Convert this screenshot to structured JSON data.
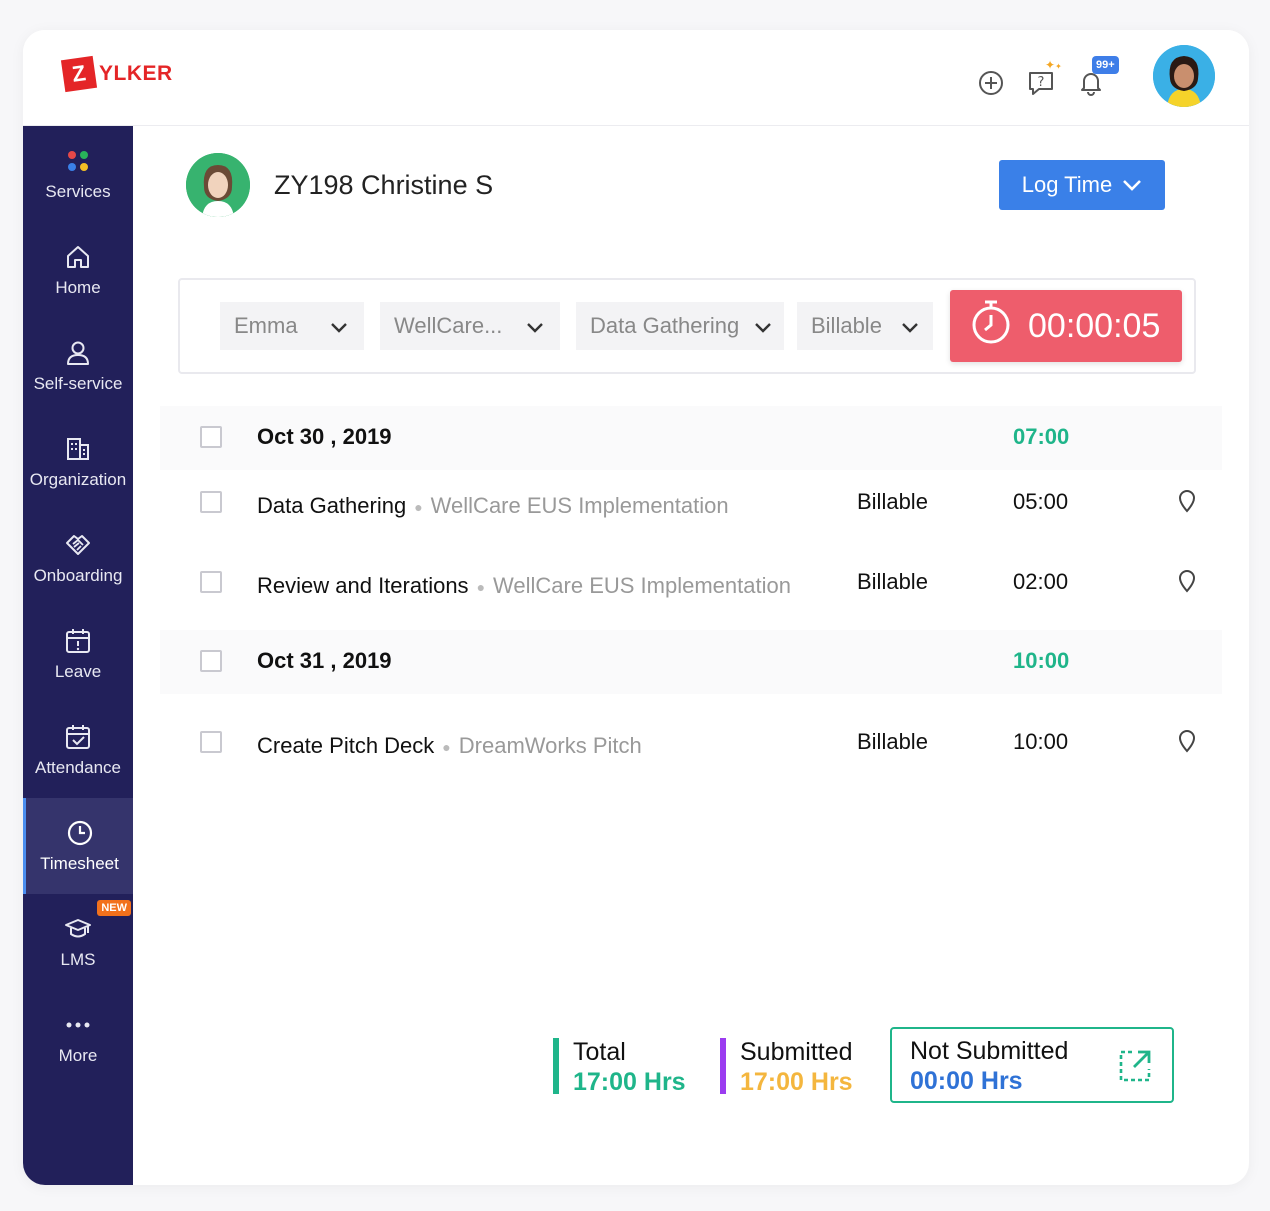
{
  "brand": {
    "logo_letter": "Z",
    "logo_text": "YLKER",
    "color": "#e42527"
  },
  "header": {
    "icons": [
      "add-icon",
      "help-icon",
      "bell-icon"
    ],
    "notification_badge": "99+",
    "profile_avatar": "user-avatar"
  },
  "sidebar": {
    "items": [
      {
        "label": "Services",
        "icon": "services-icon"
      },
      {
        "label": "Home",
        "icon": "home-icon"
      },
      {
        "label": "Self-service",
        "icon": "person-icon"
      },
      {
        "label": "Organization",
        "icon": "building-icon"
      },
      {
        "label": "Onboarding",
        "icon": "handshake-icon"
      },
      {
        "label": "Leave",
        "icon": "calendar-icon"
      },
      {
        "label": "Attendance",
        "icon": "calendar-check-icon"
      },
      {
        "label": "Timesheet",
        "icon": "clock-icon",
        "active": true
      },
      {
        "label": "LMS",
        "icon": "graduation-icon",
        "badge": "NEW"
      },
      {
        "label": "More",
        "icon": "more-icon"
      }
    ]
  },
  "profile": {
    "name": "ZY198 Christine S"
  },
  "log_time": {
    "label": "Log Time"
  },
  "filters": {
    "user": "Emma",
    "project": "WellCare...",
    "job": "Data Gathering",
    "billing": "Billable"
  },
  "timer": {
    "value": "00:00:05"
  },
  "entries": [
    {
      "type": "date",
      "label": "Oct 30 , 2019",
      "hours": "07:00"
    },
    {
      "type": "log",
      "job": "Data Gathering",
      "project": "WellCare EUS Implementation",
      "billing": "Billable",
      "hours": "05:00"
    },
    {
      "type": "log",
      "job": "Review and Iterations",
      "project": "WellCare EUS Implementation",
      "billing": "Billable",
      "hours": "02:00"
    },
    {
      "type": "date",
      "label": "Oct 31 , 2019",
      "hours": "10:00"
    },
    {
      "type": "log",
      "job": "Create Pitch Deck",
      "project": "DreamWorks Pitch",
      "billing": "Billable",
      "hours": "10:00"
    }
  ],
  "totals": {
    "total": {
      "label": "Total",
      "value": "17:00 Hrs",
      "color": "#1fb58a"
    },
    "submitted": {
      "label": "Submitted",
      "value": "17:00 Hrs",
      "color": "#f4b63e",
      "bar_color": "#9b3cf0"
    },
    "not_submitted": {
      "label": "Not Submitted",
      "value": "00:00 Hrs",
      "color": "#2f72d6"
    }
  },
  "colors": {
    "sidebar": "#22205a",
    "accent": "#3a80e8",
    "timer": "#ee5d6c",
    "green": "#1fb58a"
  }
}
